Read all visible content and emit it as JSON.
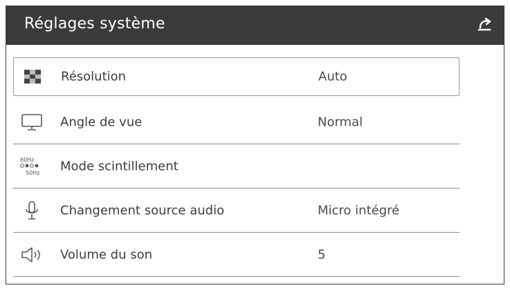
{
  "header": {
    "title": "Réglages système",
    "back_icon": "back-arrow-icon"
  },
  "settings": [
    {
      "icon": "resolution-icon",
      "label": "Résolution",
      "value": "Auto",
      "selected": true
    },
    {
      "icon": "monitor-icon",
      "label": "Angle de vue",
      "value": "Normal",
      "selected": false
    },
    {
      "icon": "flicker-mode-icon",
      "label": "Mode scintillement",
      "value": "",
      "selected": false,
      "icon_text": {
        "top": "60Hz",
        "bottom": "50Hz"
      }
    },
    {
      "icon": "microphone-icon",
      "label": "Changement source audio",
      "value": "Micro intégré",
      "selected": false
    },
    {
      "icon": "speaker-icon",
      "label": "Volume du son",
      "value": "5",
      "selected": false
    }
  ],
  "colors": {
    "header_bg": "#3b3b3b",
    "text": "#3c3c3c",
    "divider": "#8a8a8a"
  }
}
